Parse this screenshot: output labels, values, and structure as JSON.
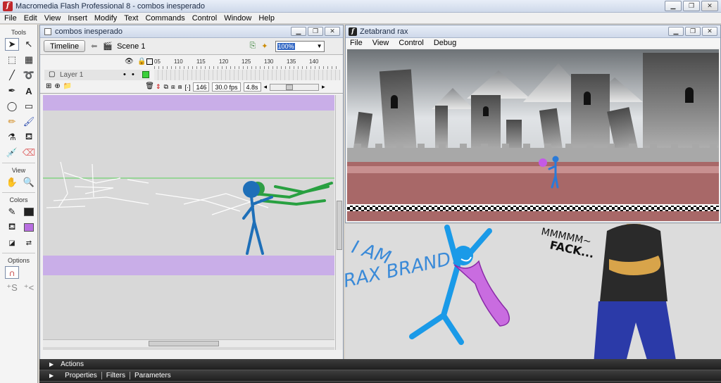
{
  "app": {
    "title": "Macromedia Flash Professional 8 - combos inesperado",
    "menu": [
      "File",
      "Edit",
      "View",
      "Insert",
      "Modify",
      "Text",
      "Commands",
      "Control",
      "Window",
      "Help"
    ]
  },
  "tools_panel": {
    "tools_label": "Tools",
    "view_label": "View",
    "colors_label": "Colors",
    "options_label": "Options",
    "stroke_color": "#222222",
    "fill_color": "#b86ee0"
  },
  "document": {
    "title": "combos inesperado",
    "timeline_button": "Timeline",
    "scene_label": "Scene 1",
    "zoom_value": "100%",
    "frame_numbers": [
      "05",
      "110",
      "115",
      "120",
      "125",
      "130",
      "135",
      "140"
    ],
    "layer_name": "Layer 1",
    "current_frame": "146",
    "frame_rate": "30.0 fps",
    "elapsed_time": "4.8s"
  },
  "swf_player": {
    "title": "Zetabrand rax",
    "menu": [
      "File",
      "View",
      "Control",
      "Debug"
    ]
  },
  "bottom_panels": {
    "actions_label": "Actions",
    "tabs": [
      "Properties",
      "Filters",
      "Parameters"
    ]
  },
  "drawing": {
    "shout_text_line1": "I AM",
    "shout_text_line2": "RAX BRAND!!!",
    "mumble_text_line1": "MMMMM~",
    "mumble_text_line2": "FACK..."
  }
}
